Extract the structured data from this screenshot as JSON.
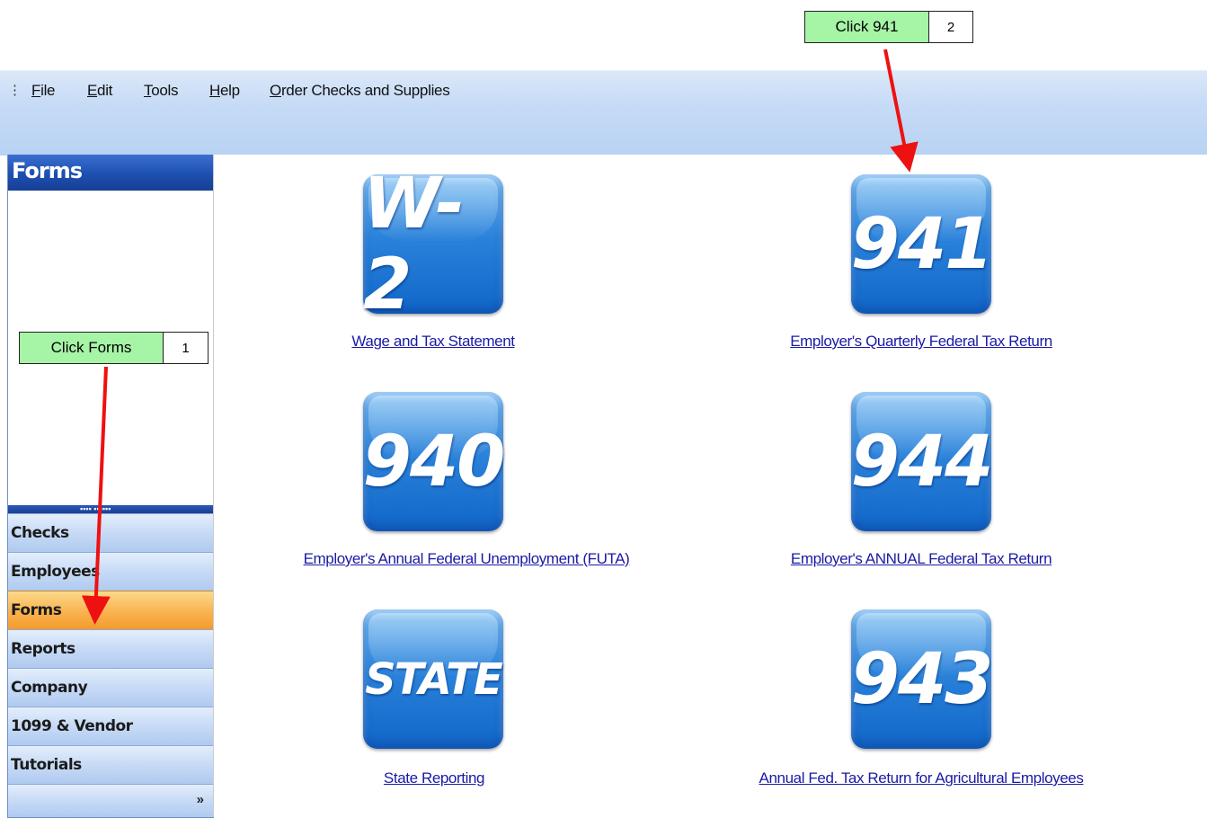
{
  "menu": {
    "items": [
      {
        "label": "File",
        "accel": "F",
        "rest": "ile"
      },
      {
        "label": "Edit",
        "accel": "E",
        "rest": "dit"
      },
      {
        "label": "Tools",
        "accel": "T",
        "rest": "ools"
      },
      {
        "label": "Help",
        "accel": "H",
        "rest": "elp"
      },
      {
        "label": "Order Checks and Supplies",
        "accel": "O",
        "rest": "rder Checks and Supplies"
      }
    ]
  },
  "sidebar": {
    "title": "Forms",
    "items": [
      {
        "label": "Checks"
      },
      {
        "label": "Employees"
      },
      {
        "label": "Forms",
        "active": true
      },
      {
        "label": "Reports"
      },
      {
        "label": "Company"
      },
      {
        "label": "1099 & Vendor"
      },
      {
        "label": "Tutorials"
      }
    ],
    "more_glyph": "»"
  },
  "forms": [
    {
      "icon_text": "W-2",
      "link": "Wage and Tax Statement"
    },
    {
      "icon_text": "941",
      "link": "Employer's Quarterly Federal Tax Return"
    },
    {
      "icon_text": "940",
      "link": "Employer's Annual Federal Unemployment (FUTA)"
    },
    {
      "icon_text": "944",
      "link": "Employer's ANNUAL Federal Tax Return"
    },
    {
      "icon_text": "STATE",
      "link": "State Reporting"
    },
    {
      "icon_text": "943",
      "link": "Annual Fed. Tax Return for Agricultural Employees"
    }
  ],
  "callouts": [
    {
      "label": "Click Forms",
      "number": "1"
    },
    {
      "label": "Click 941",
      "number": "2"
    }
  ],
  "colors": {
    "callout_bg": "#a6f4a6",
    "arrow": "#ee1111",
    "active_nav": "#f9b654",
    "link": "#1a1aa6"
  }
}
